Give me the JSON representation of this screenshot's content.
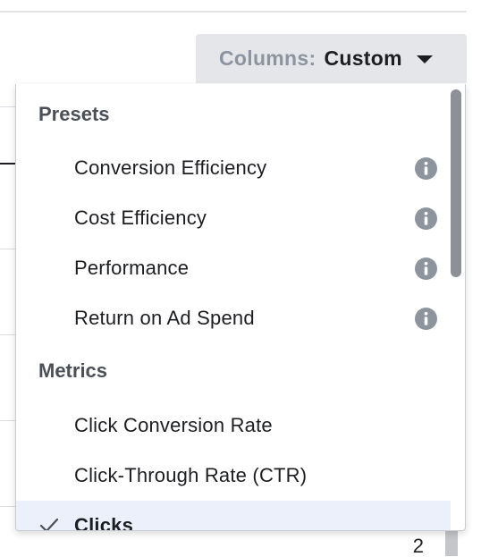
{
  "columns_button": {
    "label": "Columns:",
    "value": "Custom",
    "icon": "caret-down-icon"
  },
  "dropdown": {
    "sections": [
      {
        "header": "Presets",
        "items": [
          {
            "label": "Conversion Efficiency",
            "icon": "info-icon"
          },
          {
            "label": "Cost Efficiency",
            "icon": "info-icon"
          },
          {
            "label": "Performance",
            "icon": "info-icon"
          },
          {
            "label": "Return on Ad Spend",
            "icon": "info-icon"
          }
        ]
      },
      {
        "header": "Metrics",
        "items": [
          {
            "label": "Click Conversion Rate",
            "selected": false
          },
          {
            "label": "Click-Through Rate (CTR)",
            "selected": false
          },
          {
            "label": "Clicks",
            "selected": true,
            "icon": "check-icon"
          }
        ]
      }
    ]
  },
  "background": {
    "cell_value": "2"
  },
  "colors": {
    "button_bg": "#e4e6ea",
    "selected_row_bg": "#ebf0fa",
    "header_text": "#4b4f56",
    "icon_gray": "#8d949e"
  }
}
